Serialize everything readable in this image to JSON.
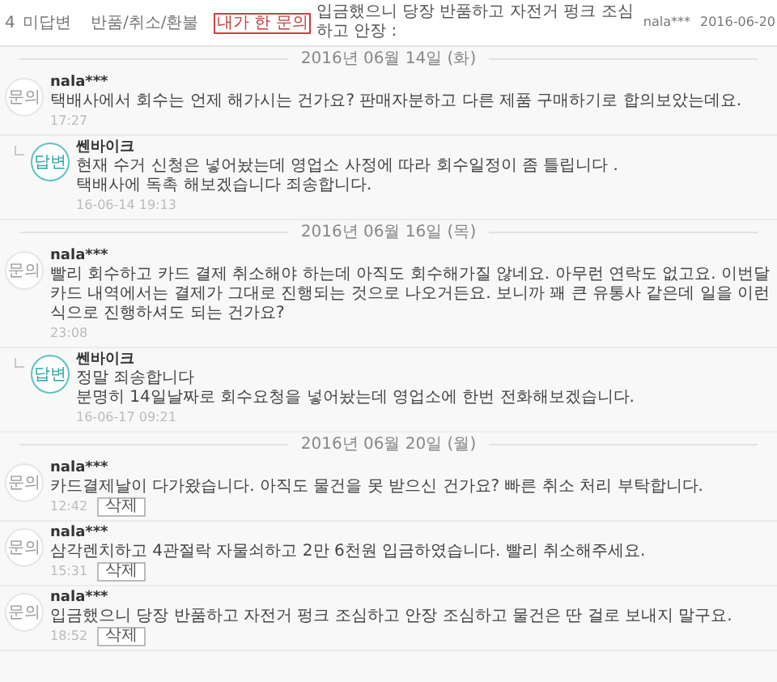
{
  "header_row": {
    "number": "4",
    "status": "미답변",
    "category": "반품/취소/환불",
    "badge": "내가 한 문의",
    "title": "입금했으니 당장 반품하고 자전거 펑크 조심하고 안장 :",
    "author": "nala***",
    "date": "2016-06-20"
  },
  "groups": [
    {
      "date": "2016년 06월 14일 (화)",
      "messages": [
        {
          "kind": "question",
          "badge": "문의",
          "author": "nala***",
          "lines": [
            "택배사에서 회수는 언제 해가시는 건가요? 판매자분하고 다른 제품 구매하기로 합의보았는데요."
          ],
          "time": "17:27"
        },
        {
          "kind": "answer",
          "badge": "답변",
          "author": "쎈바이크",
          "lines": [
            "현재 수거 신청은 넣어놨는데 영업소 사정에 따라 회수일정이 좀 틀립니다 .",
            "택배사에 독촉 해보겠습니다 죄송합니다."
          ],
          "time": "16-06-14 19:13"
        }
      ]
    },
    {
      "date": "2016년 06월 16일 (목)",
      "messages": [
        {
          "kind": "question",
          "badge": "문의",
          "author": "nala***",
          "lines": [
            "빨리 회수하고 카드 결제 취소해야 하는데 아직도 회수해가질 않네요. 아무런 연락도 없고요. 이번달 카드 내역에서는 결제가 그대로 진행되는 것으로 나오거든요. 보니까 꽤 큰 유통사 같은데 일을 이런식으로 진행하셔도 되는 건가요?"
          ],
          "time": "23:08"
        },
        {
          "kind": "answer",
          "badge": "답변",
          "author": "쎈바이크",
          "lines": [
            "정말 죄송합니다",
            "분명히 14일날짜로 회수요청을 넣어놨는데 영업소에 한번 전화해보겠습니다."
          ],
          "time": "16-06-17 09:21"
        }
      ]
    },
    {
      "date": "2016년 06월 20일 (월)",
      "messages": [
        {
          "kind": "question",
          "badge": "문의",
          "author": "nala***",
          "lines": [
            "카드결제날이 다가왔습니다. 아직도 물건을 못 받으신 건가요? 빠른 취소 처리 부탁합니다."
          ],
          "time": "12:42",
          "delete": "삭제"
        },
        {
          "kind": "question",
          "badge": "문의",
          "author": "nala***",
          "lines": [
            "삼각렌치하고 4관절락 자물쇠하고 2만 6천원 입금하였습니다. 빨리 취소해주세요."
          ],
          "time": "15:31",
          "delete": "삭제"
        },
        {
          "kind": "question",
          "badge": "문의",
          "author": "nala***",
          "lines": [
            "입금했으니 당장 반품하고 자전거 펑크 조심하고 안장 조심하고 물건은 딴 걸로 보내지 말구요."
          ],
          "time": "18:52",
          "delete": "삭제"
        }
      ]
    }
  ]
}
